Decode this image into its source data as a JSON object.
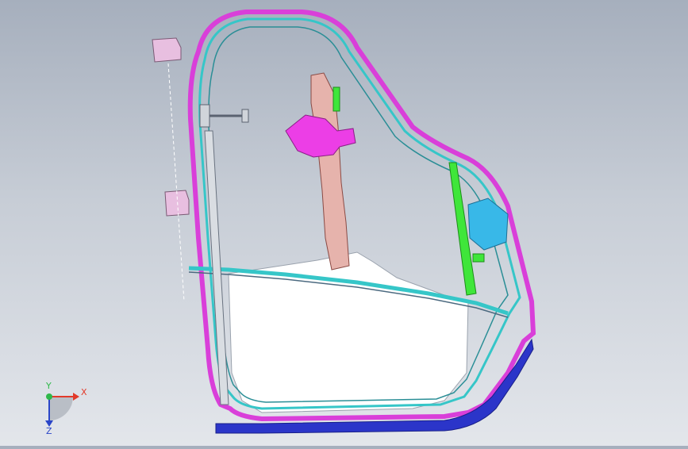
{
  "triad": {
    "x_label": "X",
    "y_label": "Y",
    "z_label": "Z",
    "x_color": "#e23a2a",
    "y_color": "#2fb84a",
    "z_color": "#2a45c8"
  },
  "colors": {
    "outer_frame": "#d93fd9",
    "inner_channel": "#36c6c8",
    "lower_seal": "#2b35c9",
    "regulator_rail": "#e6b3ac",
    "motor": "#ec3ee6",
    "guide_rail": "#3fe63a",
    "bracket_blue": "#38b8e8",
    "hinge": "#e8bfe0",
    "glass": "#ffffff"
  }
}
